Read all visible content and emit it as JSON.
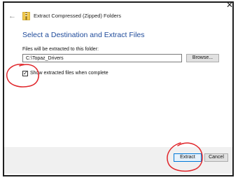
{
  "dialog": {
    "title": "Extract Compressed (Zipped) Folders",
    "close_glyph": "✕",
    "back_glyph": "←",
    "heading": "Select a Destination and Extract Files",
    "destination_label": "Files will be extracted to this folder:",
    "destination_value": "C:\\Topaz_Drivers",
    "browse_label": "Browse...",
    "show_files_label": "Show extracted files when complete",
    "show_files_checked": true,
    "check_glyph": "✓",
    "extract_label": "Extract",
    "cancel_label": "Cancel"
  },
  "colors": {
    "heading": "#1e4a9a",
    "annotation": "#e0262b",
    "primary_border": "#0078d7",
    "footer_bg": "#f0f0f0"
  },
  "icons": {
    "folder": "zipped-folder-icon",
    "back": "back-arrow-icon",
    "close": "close-icon"
  }
}
